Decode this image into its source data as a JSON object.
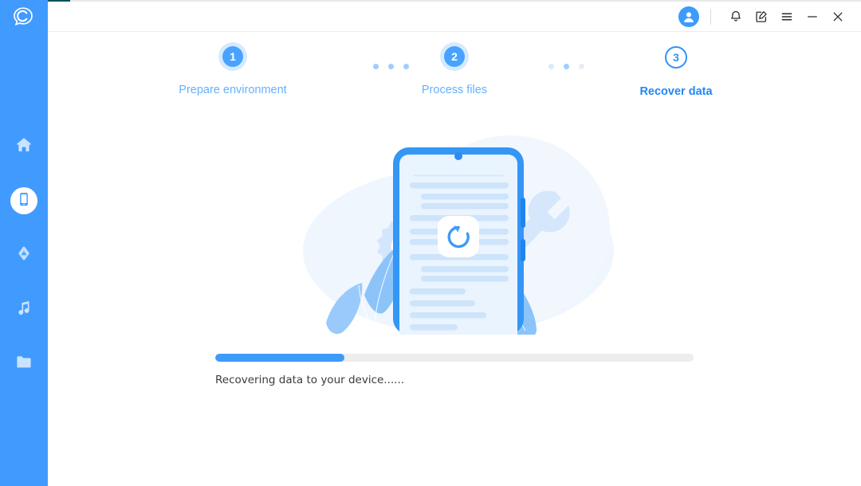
{
  "window": {
    "brand_color": "#419bff",
    "accent_color": "#3d9bfb",
    "titlebar": {
      "avatar_name": "user-avatar",
      "buttons": [
        {
          "name": "notifications-button",
          "icon": "bell-icon",
          "label": "Notifications"
        },
        {
          "name": "feedback-button",
          "icon": "edit-note-icon",
          "label": "Feedback"
        },
        {
          "name": "menu-button",
          "icon": "hamburger-menu-icon",
          "label": "Menu"
        },
        {
          "name": "minimize-button",
          "icon": "minimize-icon",
          "label": "Minimize"
        },
        {
          "name": "close-button",
          "icon": "close-icon",
          "label": "Close"
        }
      ]
    }
  },
  "sidebar": {
    "logo_icon": "chat-bubble-c-logo",
    "items": [
      {
        "name": "sidebar-item-home",
        "icon": "home-icon",
        "label": "Home",
        "active": false
      },
      {
        "name": "sidebar-item-phone",
        "icon": "phone-icon",
        "label": "Phone",
        "active": true
      },
      {
        "name": "sidebar-item-cloud",
        "icon": "cloud-icon",
        "label": "Cloud",
        "active": false
      },
      {
        "name": "sidebar-item-music",
        "icon": "music-note-icon",
        "label": "Music",
        "active": false
      },
      {
        "name": "sidebar-item-files",
        "icon": "folder-icon",
        "label": "Files",
        "active": false
      }
    ]
  },
  "stepper": {
    "steps": [
      {
        "number": "1",
        "label": "Prepare environment",
        "state": "done"
      },
      {
        "number": "2",
        "label": "Process files",
        "state": "done"
      },
      {
        "number": "3",
        "label": "Recover data",
        "state": "current"
      }
    ],
    "connector_dots": 3
  },
  "illustration": {
    "name": "phone-recovery-illustration",
    "elements": [
      "gear-icon",
      "wrench-icon",
      "leaf-shape",
      "smartphone-shape",
      "refresh-icon"
    ],
    "colors": {
      "blob": "#EFF6FE",
      "gear": "#D4E6FC",
      "wrench": "#D6E7FC",
      "leaf": "#8CC4FA",
      "phone_frame": "#3496F5",
      "phone_screen": "#EAF4FE",
      "text_line": "#CDE4FB",
      "refresh": "#3D9BFB"
    }
  },
  "progress": {
    "name": "recovery-progress-bar",
    "percent": 27,
    "status_text": "Recovering data to your device......"
  }
}
